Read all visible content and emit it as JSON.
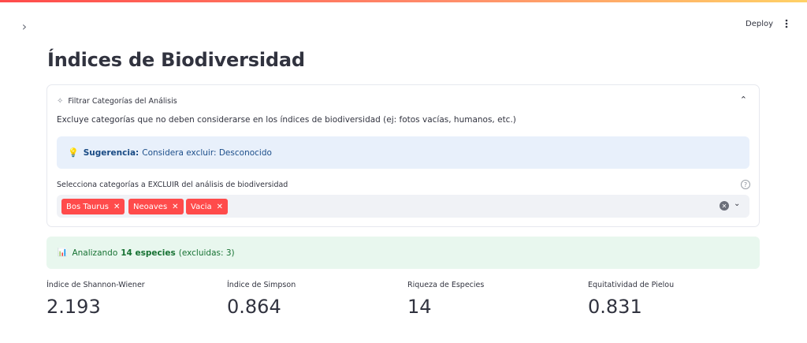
{
  "accent_colors": {
    "primary": "#ff4b4b",
    "info_bg": "#e8f0fb",
    "success_bg": "#e8f7ee"
  },
  "header": {
    "collapse_icon": "chevron-right-icon",
    "deploy_label": "Deploy",
    "menu_icon": "vertical-dots-icon"
  },
  "page": {
    "title": "Índices de Biodiversidad"
  },
  "expander": {
    "icon": "sparkle-icon",
    "label": "Filtrar Categorías del Análisis",
    "description": "Excluye categorías que no deben considerarse en los índices de biodiversidad (ej: fotos vacías, humanos, etc.)",
    "suggestion": {
      "bold": "Sugerencia:",
      "text": "Considera excluir: Desconocido"
    },
    "multiselect": {
      "label": "Selecciona categorías a EXCLUIR del análisis de biodiversidad",
      "chips": [
        "Bos Taurus",
        "Neoaves",
        "Vacia"
      ]
    }
  },
  "analysis_summary": {
    "prefix": "Analizando",
    "bold": "14 especies",
    "suffix": "(excluidas: 3)"
  },
  "metrics": [
    {
      "label": "Índice de Shannon-Wiener",
      "value": "2.193"
    },
    {
      "label": "Índice de Simpson",
      "value": "0.864"
    },
    {
      "label": "Riqueza de Especies",
      "value": "14"
    },
    {
      "label": "Equitatividad de Pielou",
      "value": "0.831"
    }
  ]
}
